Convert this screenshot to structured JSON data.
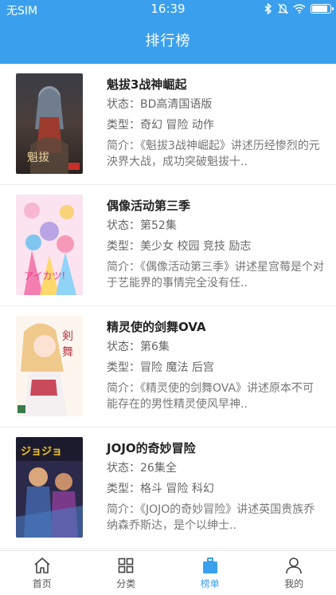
{
  "status_bar": {
    "carrier": "无SIM",
    "time": "16:39",
    "battery_level": 0.95
  },
  "nav": {
    "title": "排行榜"
  },
  "items": [
    {
      "name": "魁拔3战神崛起",
      "status": "状态：BD高清国语版",
      "genre": "类型：奇幻 冒险 动作",
      "intro": "简介：《魁拔3战神崛起》讲述历经惨烈的元泱界大战，成功突破魁拔十.."
    },
    {
      "name": "偶像活动第三季",
      "status": "状态：第52集",
      "genre": "类型：美少女 校园 竞技 励志",
      "intro": "简介：《偶像活动第三季》讲述星宫莓是个对于艺能界的事情完全没有任.."
    },
    {
      "name": "精灵使的剑舞OVA",
      "status": "状态：第6集",
      "genre": "类型：冒险 魔法 后宫",
      "intro": "简介：《精灵使的剑舞OVA》讲述原本不可能存在的男性精灵使风早神.."
    },
    {
      "name": "JOJO的奇妙冒险",
      "status": "状态：26集全",
      "genre": "类型：格斗 冒险 科幻",
      "intro": "简介：《JOJO的奇妙冒险》讲述英国贵族乔纳森乔斯达，是个以绅士.."
    }
  ],
  "tabs": [
    {
      "label": "首页",
      "icon": "home-icon"
    },
    {
      "label": "分类",
      "icon": "grid-icon"
    },
    {
      "label": "榜单",
      "icon": "ranking-icon",
      "active": true
    },
    {
      "label": "我的",
      "icon": "user-icon"
    }
  ],
  "colors": {
    "primary": "#3aa0ee",
    "text": "#333333"
  }
}
